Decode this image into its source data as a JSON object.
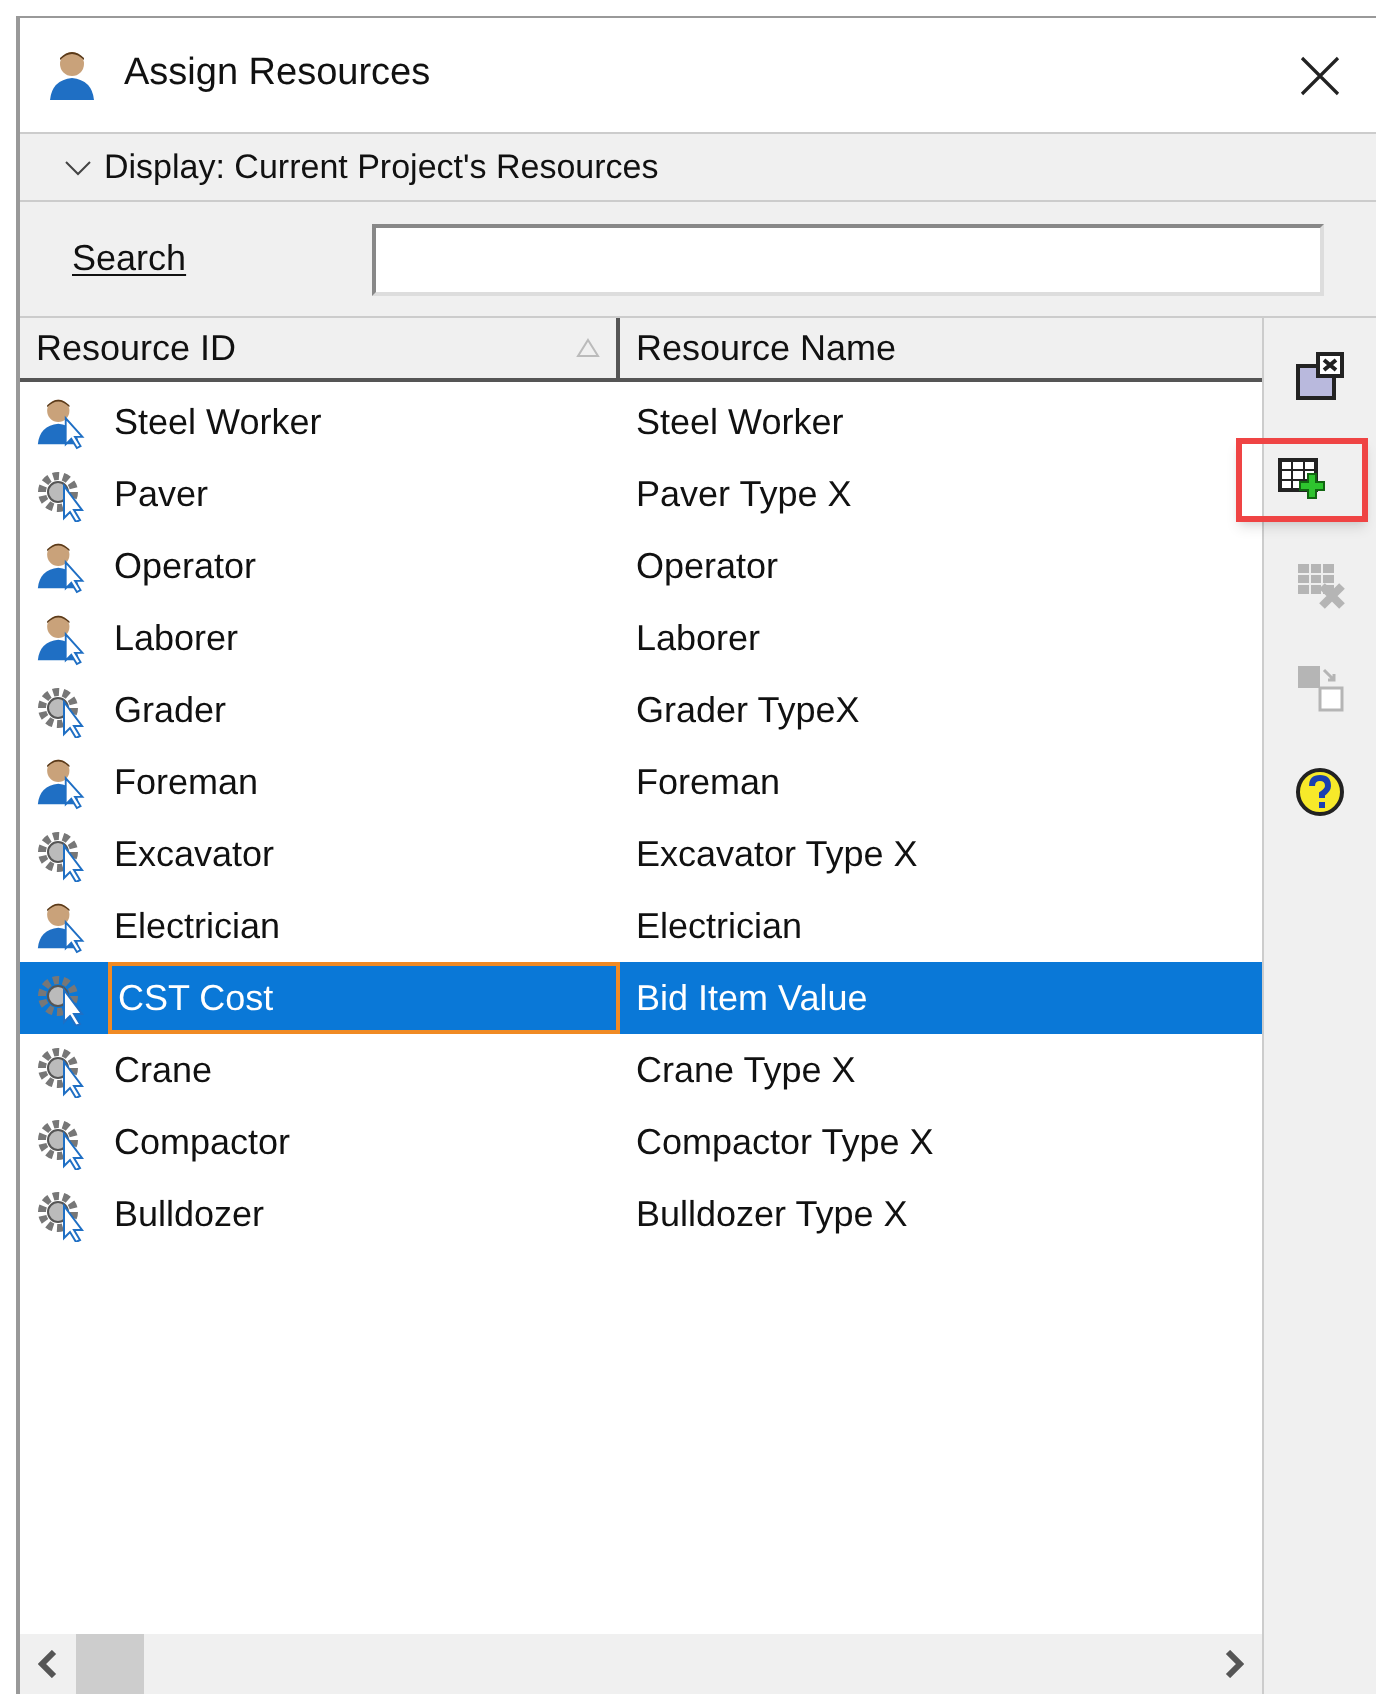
{
  "window": {
    "title": "Assign Resources"
  },
  "display_filter": {
    "label": "Display: Current Project's Resources",
    "expanded": true
  },
  "search": {
    "label": "Search"
  },
  "table": {
    "columns": [
      {
        "label": "Resource ID",
        "sorted": true
      },
      {
        "label": "Resource Name",
        "sorted": false
      }
    ],
    "rows": [
      {
        "kind": "labor",
        "id": "Steel Worker",
        "name": "Steel Worker",
        "selected": false
      },
      {
        "kind": "equipment",
        "id": "Paver",
        "name": "Paver Type X",
        "selected": false
      },
      {
        "kind": "labor",
        "id": "Operator",
        "name": "Operator",
        "selected": false
      },
      {
        "kind": "labor",
        "id": "Laborer",
        "name": "Laborer",
        "selected": false
      },
      {
        "kind": "equipment",
        "id": "Grader",
        "name": "Grader TypeX",
        "selected": false
      },
      {
        "kind": "labor",
        "id": "Foreman",
        "name": "Foreman",
        "selected": false
      },
      {
        "kind": "equipment",
        "id": "Excavator",
        "name": "Excavator Type X",
        "selected": false
      },
      {
        "kind": "labor",
        "id": "Electrician",
        "name": "Electrician",
        "selected": false
      },
      {
        "kind": "equipment",
        "id": "CST Cost",
        "name": "Bid Item Value",
        "selected": true
      },
      {
        "kind": "equipment",
        "id": "Crane",
        "name": "Crane Type X",
        "selected": false
      },
      {
        "kind": "equipment",
        "id": "Compactor",
        "name": "Compactor Type X",
        "selected": false
      },
      {
        "kind": "equipment",
        "id": "Bulldozer",
        "name": "Bulldozer Type X",
        "selected": false
      }
    ]
  },
  "toolbar": [
    {
      "kind": "close-panel",
      "disabled": false,
      "highlighted": false
    },
    {
      "kind": "add",
      "disabled": false,
      "highlighted": true
    },
    {
      "kind": "remove",
      "disabled": true,
      "highlighted": false
    },
    {
      "kind": "replace",
      "disabled": true,
      "highlighted": false
    },
    {
      "kind": "help",
      "disabled": false,
      "highlighted": false
    }
  ]
}
